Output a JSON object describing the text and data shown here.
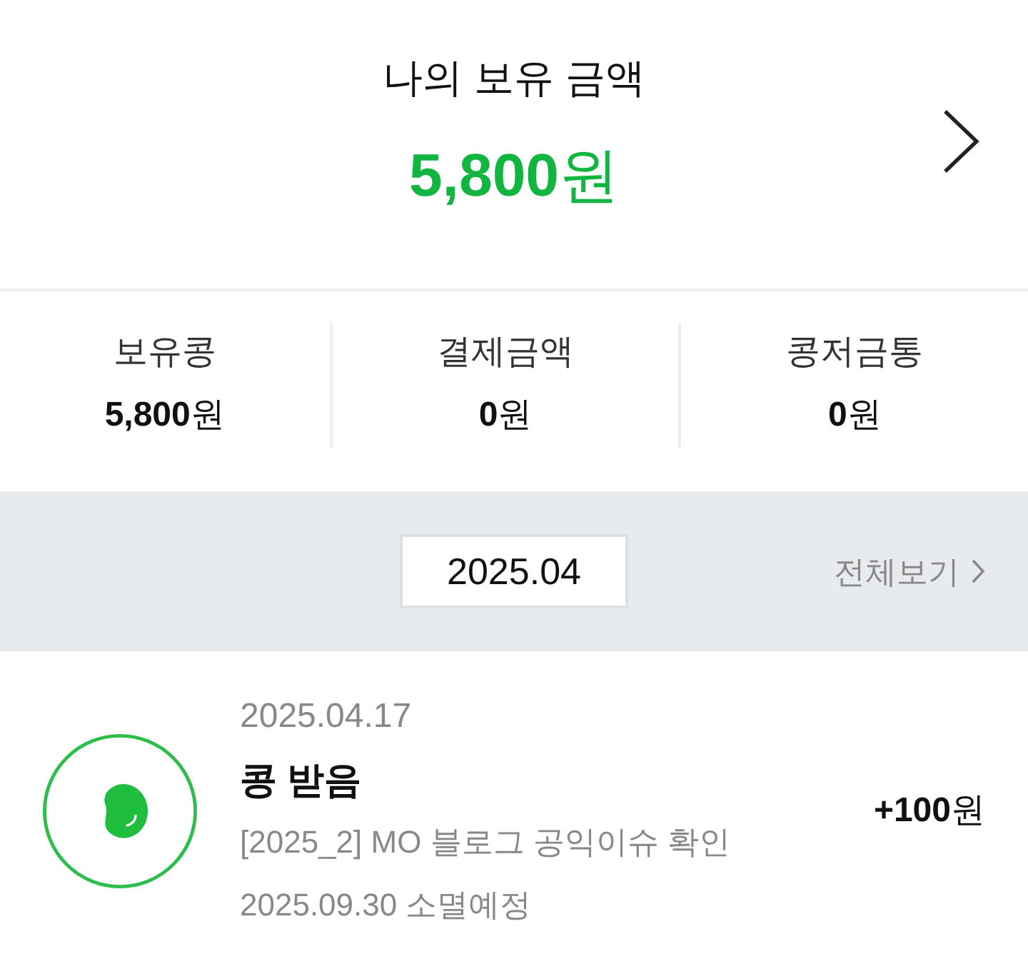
{
  "balance": {
    "title": "나의 보유 금액",
    "amount": "**5,800**원"
  },
  "summary": [
    {
      "label": "보유콩",
      "amount": "**5,800**원"
    },
    {
      "label": "결제금액",
      "amount": "**0**원"
    },
    {
      "label": "콩저금통",
      "amount": "**0**원"
    }
  ],
  "period": {
    "month": "2025.04",
    "view_all": "전체보기"
  },
  "transactions": [
    {
      "date": "2025.04.17",
      "title": "콩 받음",
      "description": "[2025_2] MO 블로그 공익이슈 확인",
      "expiry": "2025.09.30 소멸예정",
      "amount": "**+100**원"
    }
  ]
}
